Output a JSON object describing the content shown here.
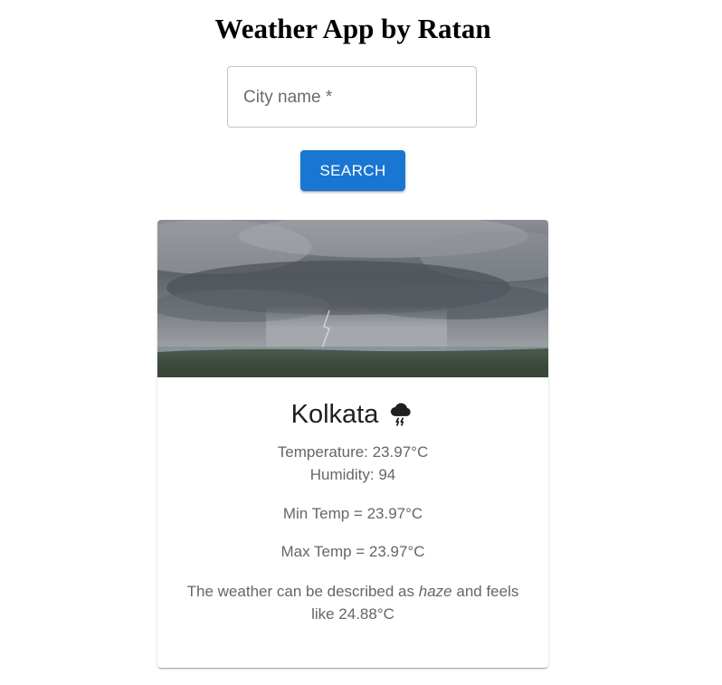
{
  "app": {
    "title": "Weather App by Ratan"
  },
  "search": {
    "label": "City name",
    "required_marker": "*",
    "value": "",
    "button_label": "Search"
  },
  "card": {
    "image_description": "storm clouds with rain and lightning",
    "city": "Kolkata",
    "weather_icon": "thunderstorm-cloud-icon",
    "temperature_label": "Temperature: 23.97°C",
    "humidity_label": "Humidity: 94",
    "min_temp_label": "Min Temp = 23.97°C",
    "max_temp_label": "Max Temp = 23.97°C",
    "description_prefix": "The weather can be described as",
    "description_condition": "haze",
    "description_suffix": "and feels like 24.88°C"
  },
  "colors": {
    "primary": "#1976d2",
    "text_secondary": "#666666",
    "text_primary": "#1f1f1f",
    "input_border": "#c4c4c4"
  }
}
